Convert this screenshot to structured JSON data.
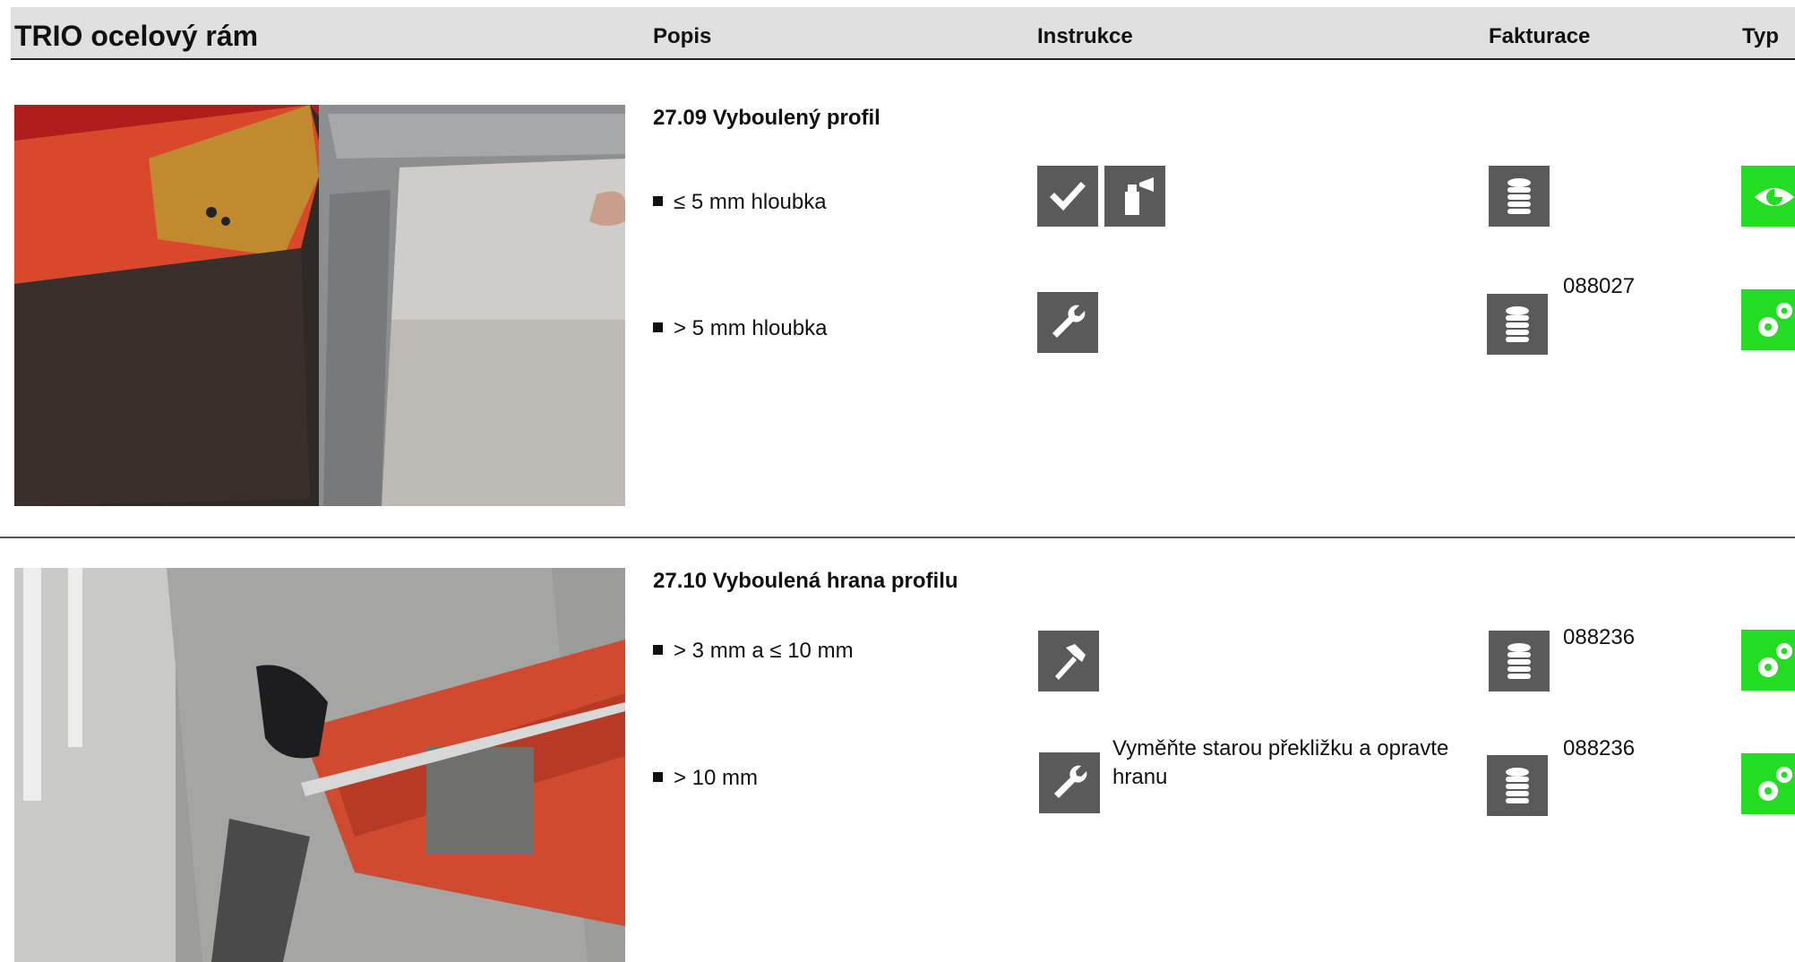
{
  "header": {
    "title": "TRIO ocelový rám",
    "col_popis": "Popis",
    "col_instrukce": "Instrukce",
    "col_fakturace": "Fakturace",
    "col_typ": "Typ"
  },
  "sections": [
    {
      "title": "27.09 Vyboulený profil",
      "rows": [
        {
          "text": "≤ 5 mm hloubka",
          "icons": [
            "check-icon",
            "spray-can-icon"
          ],
          "billing_icon": "coins-stack-icon",
          "code": "",
          "type_icon": "eye-icon"
        },
        {
          "text": "> 5 mm hloubka",
          "icons": [
            "wrench-icon"
          ],
          "billing_icon": "coins-stack-icon",
          "code": "088027",
          "type_icon": "gears-icon"
        }
      ]
    },
    {
      "title": "27.10 Vyboulená hrana profilu",
      "rows": [
        {
          "text": "> 3 mm a  ≤ 10 mm",
          "icons": [
            "hammer-icon"
          ],
          "billing_icon": "coins-stack-icon",
          "code": "088236",
          "type_icon": "gears-icon"
        },
        {
          "text": "> 10 mm",
          "icons": [
            "wrench-icon"
          ],
          "note": "Vyměňte starou překližku a opravte hranu",
          "billing_icon": "coins-stack-icon",
          "code": "088236",
          "type_icon": "gears-icon"
        }
      ]
    }
  ],
  "colors": {
    "icon_bg": "#5a5a5a",
    "type_green": "#22dd22",
    "header_bg": "#e0e0e0"
  }
}
